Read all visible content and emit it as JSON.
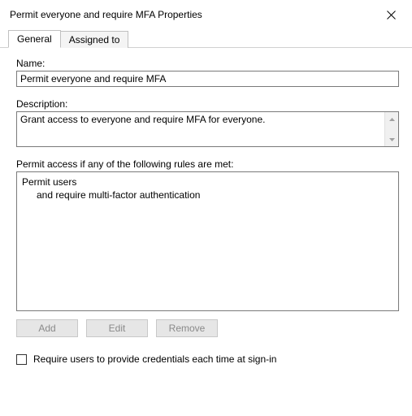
{
  "dialog": {
    "title": "Permit everyone and require MFA Properties"
  },
  "tabs": {
    "general": "General",
    "assigned_to": "Assigned to"
  },
  "labels": {
    "name": "Name:",
    "description": "Description:",
    "rules_header": "Permit access if any of the following rules are met:"
  },
  "fields": {
    "name_value": "Permit everyone and require MFA",
    "description_value": "Grant access to everyone and require MFA for everyone."
  },
  "rules": {
    "line1": "Permit users",
    "line2": "and require multi-factor authentication"
  },
  "buttons": {
    "add": "Add",
    "edit": "Edit",
    "remove": "Remove"
  },
  "checkbox": {
    "label": "Require users to provide credentials each time at sign-in",
    "checked": false
  }
}
